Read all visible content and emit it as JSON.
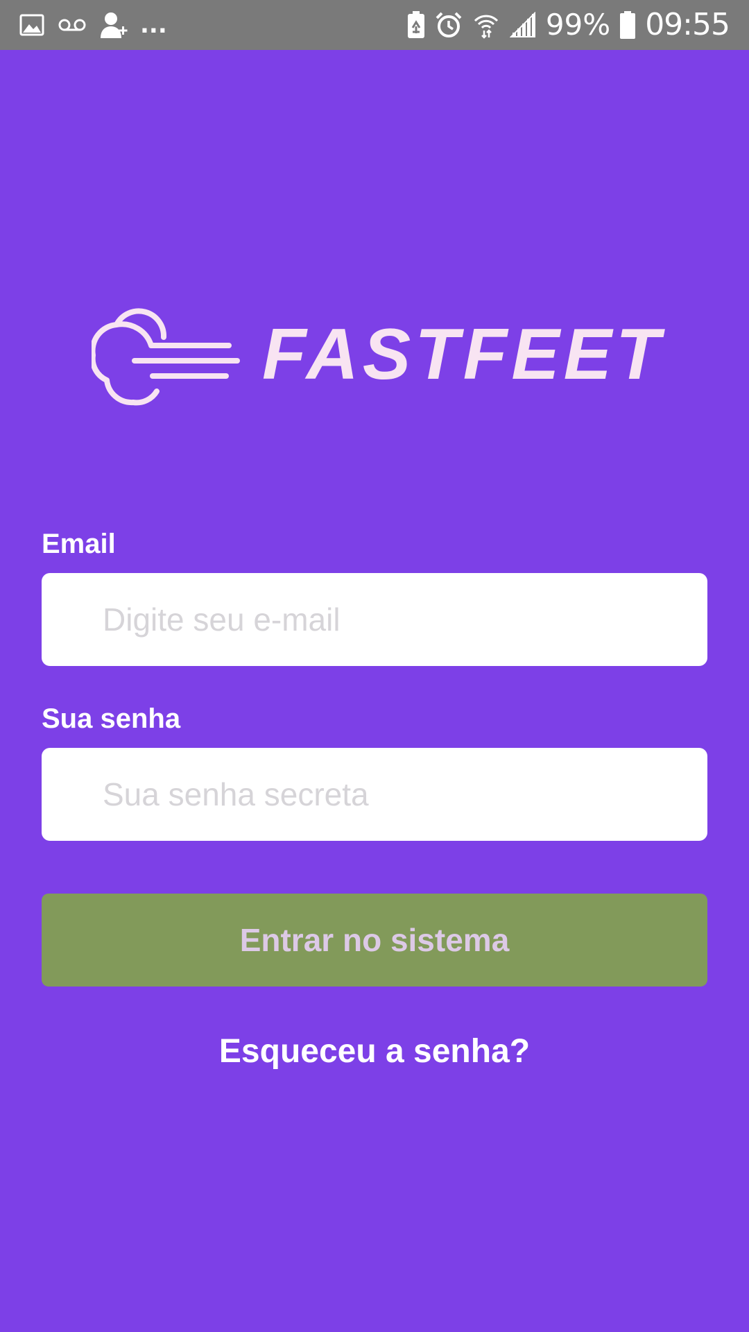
{
  "status_bar": {
    "left_icons": [
      "image-icon",
      "voicemail-icon",
      "add-contact-icon"
    ],
    "more_indicator": "...",
    "right_icons": [
      "battery-saver-icon",
      "alarm-icon",
      "wifi-icon",
      "signal-icon",
      "battery-icon"
    ],
    "battery_percent": "99%",
    "time": "09:55"
  },
  "logo": {
    "icon": "speed-cloud-icon",
    "text": "FASTFEET",
    "color": "#f8e4f2"
  },
  "form": {
    "email": {
      "label": "Email",
      "value": "",
      "placeholder": "Digite seu e-mail"
    },
    "password": {
      "label": "Sua senha",
      "value": "",
      "placeholder": "Sua senha secreta"
    },
    "submit_label": "Entrar no sistema",
    "forgot_label": "Esqueceu a senha?"
  },
  "colors": {
    "background": "#7d40e7",
    "status_bar": "#7a7a7a",
    "button": "#829a5a",
    "button_text": "#dcc9e6",
    "input_bg": "#ffffff",
    "placeholder": "#d6d4d8"
  }
}
